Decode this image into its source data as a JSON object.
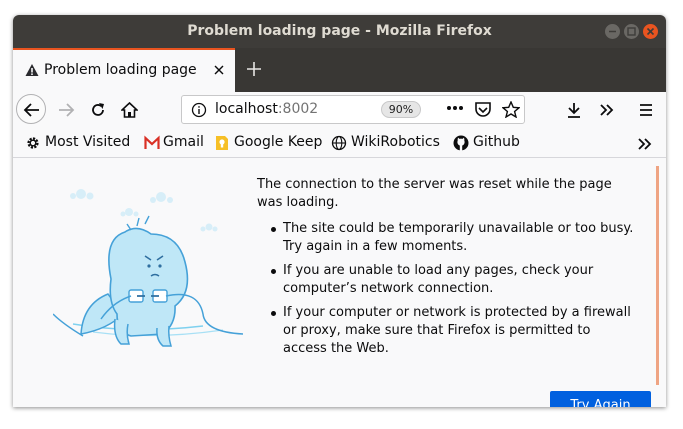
{
  "window": {
    "title": "Problem loading page - Mozilla Firefox"
  },
  "tab": {
    "label": "Problem loading page"
  },
  "urlbar": {
    "host": "localhost",
    "port": ":8002",
    "zoom": "90%"
  },
  "bookmarks": [
    {
      "label": "Most Visited",
      "icon": "gear-icon"
    },
    {
      "label": "Gmail",
      "icon": "gmail-icon"
    },
    {
      "label": "Google Keep",
      "icon": "keep-icon"
    },
    {
      "label": "WikiRobotics",
      "icon": "globe-icon"
    },
    {
      "label": "Github",
      "icon": "github-icon"
    }
  ],
  "error": {
    "message": "The connection to the server was reset while the page was loading.",
    "reasons": [
      "The site could be temporarily unavailable or too busy. Try again in a few moments.",
      "If you are unable to load any pages, check your computer’s network connection.",
      "If your computer or network is protected by a firewall or proxy, make sure that Firefox is permitted to access the Web."
    ],
    "button_label": "Try Again"
  },
  "colors": {
    "accent": "#e95420",
    "button": "#0060df",
    "titlebar": "#3e3c39"
  }
}
